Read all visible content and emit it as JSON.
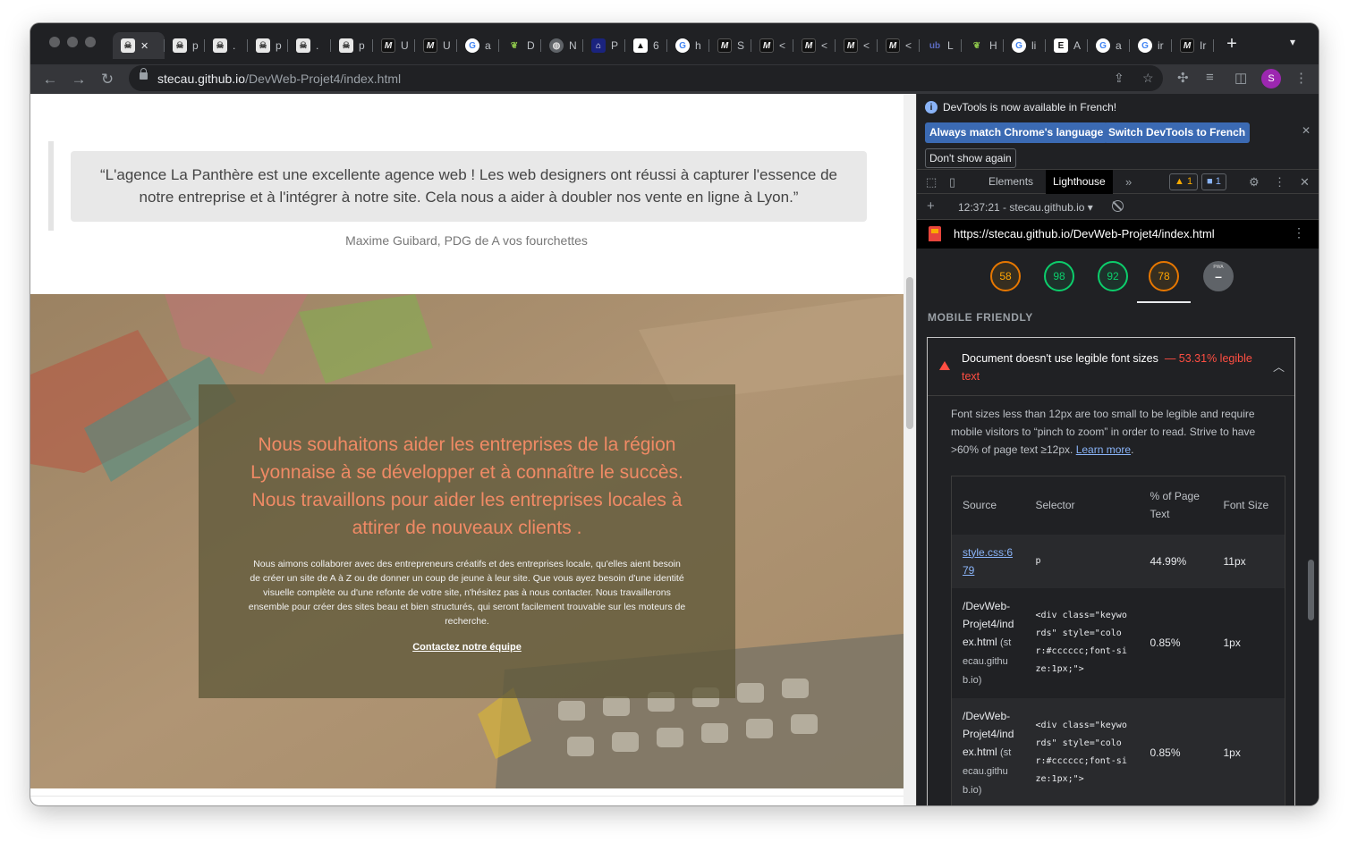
{
  "browser": {
    "tabs": [
      {
        "title": "",
        "icon": "skull-icon",
        "kind": "skull",
        "glyph": "☠",
        "active": true
      },
      {
        "title": "p",
        "icon": "skull-icon",
        "kind": "skull",
        "glyph": "☠"
      },
      {
        "title": ".",
        "icon": "skull-icon",
        "kind": "skull",
        "glyph": "☠"
      },
      {
        "title": "p",
        "icon": "skull-icon",
        "kind": "skull",
        "glyph": "☠"
      },
      {
        "title": ".",
        "icon": "skull-icon",
        "kind": "skull",
        "glyph": "☠"
      },
      {
        "title": "p",
        "icon": "skull-icon",
        "kind": "skull",
        "glyph": "☠"
      },
      {
        "title": "U",
        "icon": "m-logo-icon",
        "kind": "m",
        "glyph": "M"
      },
      {
        "title": "U",
        "icon": "m-logo-icon",
        "kind": "m",
        "glyph": "M"
      },
      {
        "title": "a",
        "icon": "google-icon",
        "kind": "g",
        "glyph": "G"
      },
      {
        "title": "D",
        "icon": "leaf-icon",
        "kind": "leaf",
        "glyph": "❦"
      },
      {
        "title": "N",
        "icon": "globe-icon",
        "kind": "globe",
        "glyph": "◍"
      },
      {
        "title": "P",
        "icon": "navy-icon",
        "kind": "nav",
        "glyph": "⌂"
      },
      {
        "title": "6",
        "icon": "mountain-icon",
        "kind": "arrow",
        "glyph": "▲"
      },
      {
        "title": "h",
        "icon": "google-icon",
        "kind": "g",
        "glyph": "G"
      },
      {
        "title": "S",
        "icon": "m-logo-icon",
        "kind": "m",
        "glyph": "M"
      },
      {
        "title": "<",
        "icon": "m-logo-icon",
        "kind": "m",
        "glyph": "M"
      },
      {
        "title": "<",
        "icon": "m-logo-icon",
        "kind": "m",
        "glyph": "M"
      },
      {
        "title": "<",
        "icon": "m-logo-icon",
        "kind": "m",
        "glyph": "M"
      },
      {
        "title": "<",
        "icon": "m-logo-icon",
        "kind": "m",
        "glyph": "M"
      },
      {
        "title": "L",
        "icon": "ub-icon",
        "kind": "ub",
        "glyph": "ub"
      },
      {
        "title": "H",
        "icon": "leaf-icon",
        "kind": "leaf",
        "glyph": "❦"
      },
      {
        "title": "li",
        "icon": "google-icon",
        "kind": "g",
        "glyph": "G"
      },
      {
        "title": "A",
        "icon": "e-icon",
        "kind": "e",
        "glyph": "E"
      },
      {
        "title": "a",
        "icon": "google-icon",
        "kind": "g",
        "glyph": "G"
      },
      {
        "title": "ir",
        "icon": "google-icon",
        "kind": "g",
        "glyph": "G"
      },
      {
        "title": "Ir",
        "icon": "m-logo-icon",
        "kind": "m",
        "glyph": "M"
      }
    ],
    "url_host": "stecau.github.io",
    "url_path": "/DevWeb-Projet4/index.html",
    "profile_initial": "S",
    "profile_color": "#9c27b0"
  },
  "page": {
    "testimonial_quote": "“L'agence La Panthère est une excellente agence web ! Les web designers ont réussi à capturer l'essence de notre entreprise et à l'intégrer à notre site. Cela nous a aider à doubler nos vente en ligne à Lyon.”",
    "testimonial_author": "Maxime Guibard, PDG de A vos fourchettes",
    "hero_title": "Nous souhaitons aider les entreprises de la région Lyonnaise à se développer et à connaître le succès. Nous travaillons pour aider les entreprises locales à attirer de nouveaux clients .",
    "hero_text": "Nous aimons collaborer avec des entrepreneurs créatifs et des entreprises locale, qu'elles aient besoin de créer un site de A à Z ou de donner un coup de jeune à leur site. Que vous ayez besoin d'une identité visuelle complète ou d'une refonte de votre site, n'hésitez pas à nous contacter. Nous travaillerons ensemble pour créer des sites beau et bien structurés, qui seront facilement trouvable sur les moteurs de recherche.",
    "hero_link": "Contactez notre équipe",
    "accent_color": "#f08a65"
  },
  "devtools": {
    "info_message": "DevTools is now available in French!",
    "match_language_button": "Always match Chrome's language",
    "switch_button": "Switch DevTools to French",
    "dont_show_button": "Don't show again",
    "tabs": [
      "Elements",
      "Lighthouse"
    ],
    "active_tab": "Lighthouse",
    "warning_count": "1",
    "message_count": "1",
    "report_selector": "12:37:21 - stecau.github.io",
    "report_url": "https://stecau.github.io/DevWeb-Projet4/index.html",
    "scores": [
      {
        "value": "58",
        "status": "orange"
      },
      {
        "value": "98",
        "status": "green"
      },
      {
        "value": "92",
        "status": "green"
      },
      {
        "value": "78",
        "status": "orange"
      }
    ],
    "pwa_label": "PWA",
    "pwa_value": "–",
    "section_title": "MOBILE FRIENDLY",
    "audit": {
      "title": "Document doesn't use legible font sizes",
      "score_text": "— 53.31% legible text",
      "description": "Font sizes less than 12px are too small to be legible and require mobile visitors to “pinch to zoom” in order to read. Strive to have >60% of page text ≥12px.",
      "learn_more": "Learn more",
      "columns": [
        "Source",
        "Selector",
        "% of Page Text",
        "Font Size"
      ],
      "rows": [
        {
          "source": "style.css:679",
          "source_sub": "",
          "selector": "p",
          "percent": "44.99%",
          "font_size": "11px"
        },
        {
          "source": "/DevWeb-Projet4/index.html",
          "source_sub": "(stecau.github.io)",
          "selector": "<div class=\"keywords\" style=\"color:#cccccc;font-size:1px;\">",
          "percent": "0.85%",
          "font_size": "1px"
        },
        {
          "source": "/DevWeb-Projet4/index.html",
          "source_sub": "(stecau.github.io)",
          "selector": "<div class=\"keywords\" style=\"color:#cccccc;font-size:1px;\">",
          "percent": "0.85%",
          "font_size": "1px"
        }
      ]
    }
  }
}
